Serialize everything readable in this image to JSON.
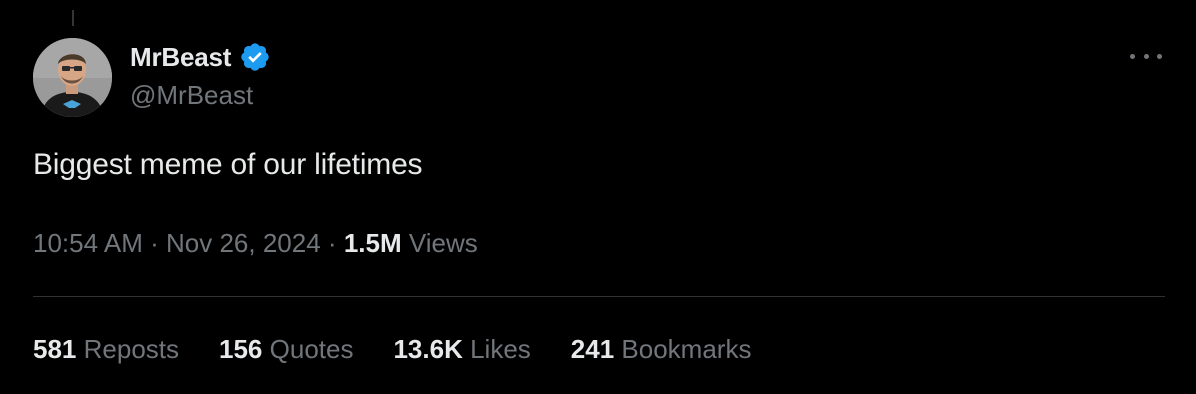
{
  "author": {
    "display_name": "MrBeast",
    "handle": "@MrBeast",
    "verified": true,
    "verified_color": "#1d9bf0",
    "avatar_icon": "profile-photo"
  },
  "tweet": {
    "text": "Biggest meme of our lifetimes",
    "time": "10:54 AM",
    "separator": "·",
    "date": "Nov 26, 2024",
    "views_count": "1.5M",
    "views_label": "Views"
  },
  "stats": [
    {
      "count": "581",
      "label": "Reposts"
    },
    {
      "count": "156",
      "label": "Quotes"
    },
    {
      "count": "13.6K",
      "label": "Likes"
    },
    {
      "count": "241",
      "label": "Bookmarks"
    }
  ],
  "colors": {
    "background": "#000000",
    "primary_text": "#e7e9ea",
    "secondary_text": "#71767b",
    "divider": "#2f3336"
  },
  "icons": {
    "more": "more-horizontal-icon",
    "verified": "verified-badge-icon"
  }
}
